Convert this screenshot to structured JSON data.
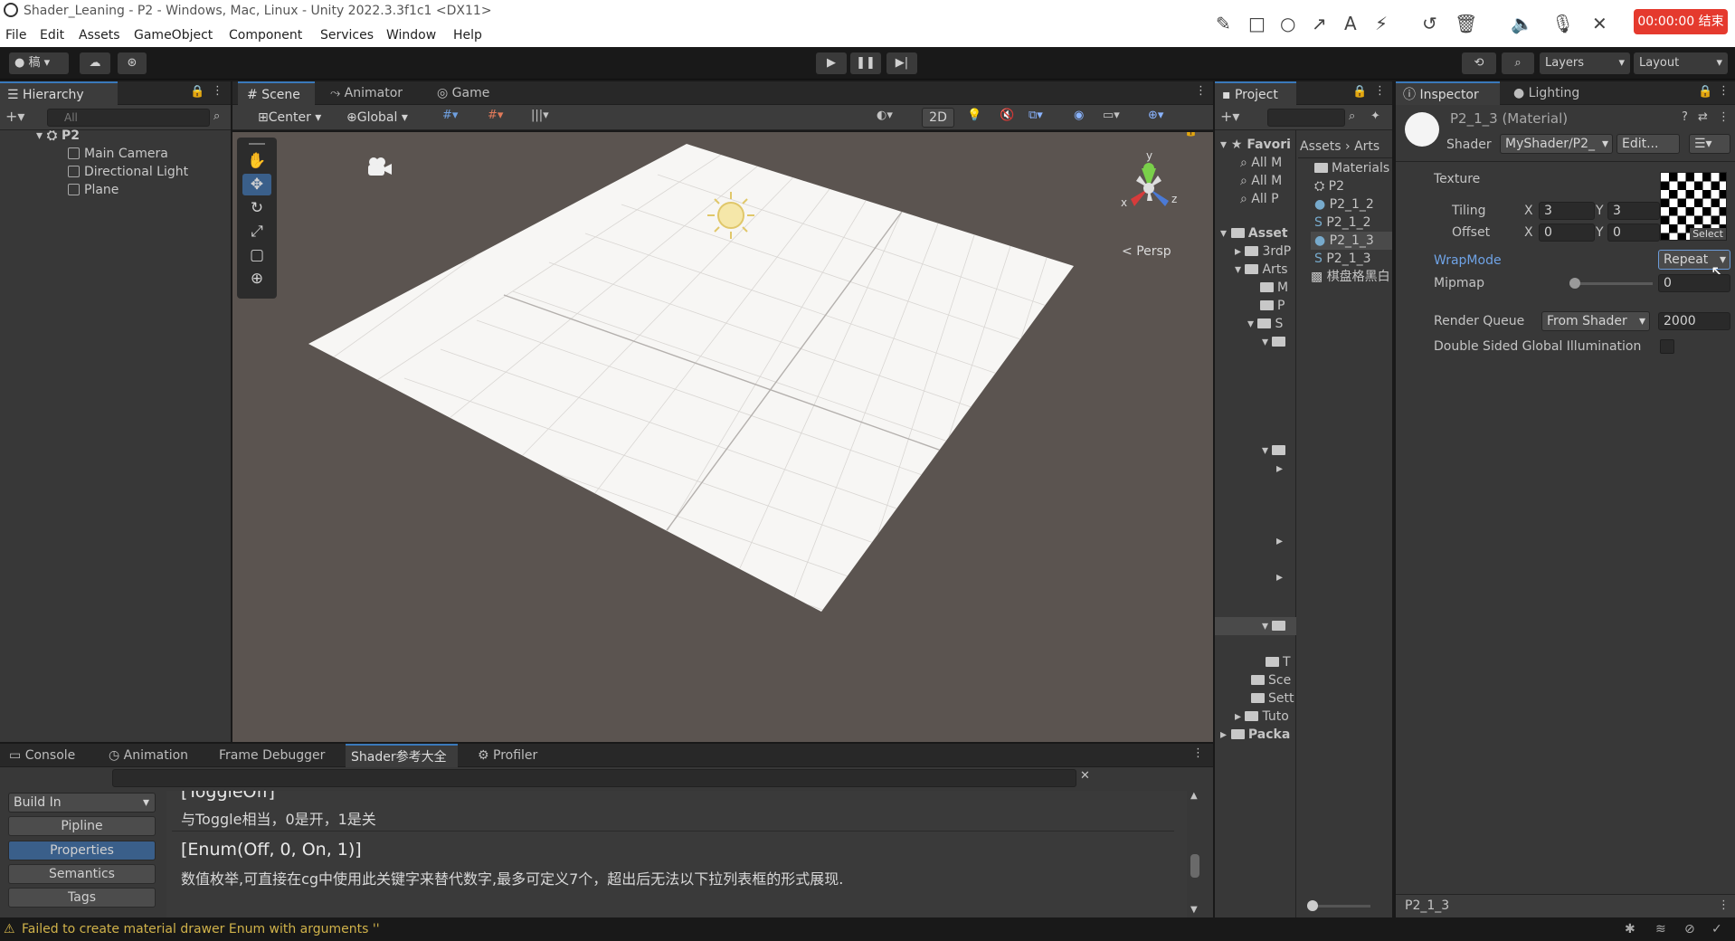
{
  "window": {
    "title": "Shader_Leaning - P2 - Windows, Mac, Linux - Unity 2022.3.3f1c1 <DX11>"
  },
  "menu": [
    "File",
    "Edit",
    "Assets",
    "GameObject",
    "Component",
    "Services",
    "Window",
    "Help"
  ],
  "recording": {
    "timer": "00:00:00 结束"
  },
  "toolbar": {
    "account": "稿",
    "layers": "Layers",
    "layout": "Layout"
  },
  "hierarchy": {
    "tab": "Hierarchy",
    "search_placeholder": "All",
    "scene": "P2",
    "items": [
      "Main Camera",
      "Directional Light",
      "Plane"
    ]
  },
  "scene_tabs": [
    "Scene",
    "Animator",
    "Game"
  ],
  "scene_toolbar": {
    "pivot": "Center",
    "space": "Global",
    "mode2d": "2D"
  },
  "gizmo": {
    "label": "Persp",
    "y": "y",
    "x": "x",
    "z": "z"
  },
  "project": {
    "tab": "Project",
    "favorites": "Favori",
    "fav_items": [
      "All M",
      "All M",
      "All P"
    ],
    "assets_root": "Asset",
    "tree": [
      "3rdP",
      "Arts",
      "M",
      "P",
      "S",
      "T",
      "Sce",
      "Sett",
      "Tuto",
      "Packa"
    ],
    "breadcrumb": [
      "Assets",
      "Arts"
    ],
    "files": [
      "Materials",
      "P2",
      "P2_1_2",
      "P2_1_2",
      "P2_1_3",
      "P2_1_3",
      "棋盘格黑白"
    ]
  },
  "inspector": {
    "tabs": [
      "Inspector",
      "Lighting"
    ],
    "title": "P2_1_3 (Material)",
    "shader_label": "Shader",
    "shader_value": "MyShader/P2_",
    "edit_button": "Edit...",
    "texture_label": "Texture",
    "tiling_label": "Tiling",
    "offset_label": "Offset",
    "tiling": {
      "x": "3",
      "y": "3"
    },
    "offset": {
      "x": "0",
      "y": "0"
    },
    "axis_x": "X",
    "axis_y": "Y",
    "select_button": "Select",
    "wrapmode_label": "WrapMode",
    "wrapmode_value": "Repeat",
    "mipmap_label": "Mipmap",
    "mipmap_value": "0",
    "render_queue_label": "Render Queue",
    "render_queue_source": "From Shader",
    "render_queue_value": "2000",
    "dsgi_label": "Double Sided Global Illumination",
    "footer": "P2_1_3"
  },
  "bottom_tabs": [
    "Console",
    "Animation",
    "Frame Debugger",
    "Shader参考大全",
    "Profiler"
  ],
  "shader_ref": {
    "category": "Build In",
    "buttons": [
      "Pipline",
      "Properties",
      "Semantics",
      "Tags"
    ],
    "entries": [
      {
        "title": "[ToggleOff]",
        "desc": "与Toggle相当，0是开，1是关"
      },
      {
        "title": "[Enum(Off, 0, On, 1)]",
        "desc": "数值枚举,可直接在cg中使用此关键字来替代数字,最多可定义7个，超出后无法以下拉列表框的形式展现."
      }
    ]
  },
  "status": {
    "message": "Failed to create material drawer Enum with arguments ''"
  }
}
